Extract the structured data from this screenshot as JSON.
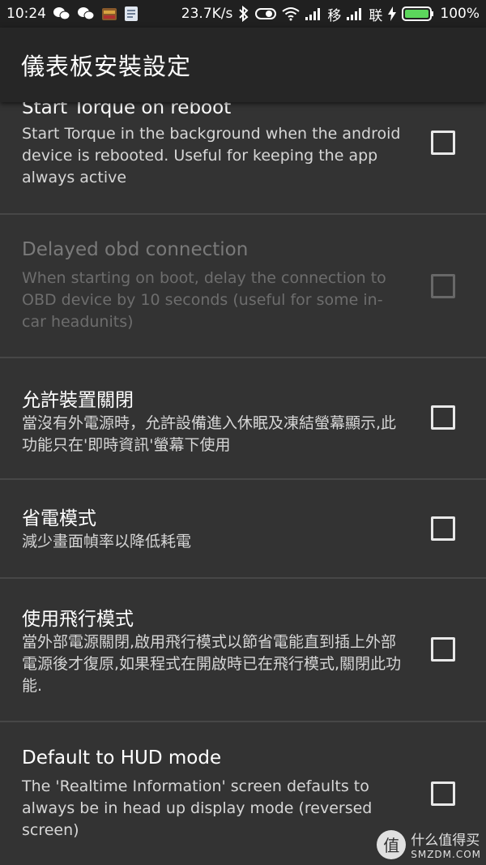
{
  "status_bar": {
    "time": "10:24",
    "net_speed": "23.7K/s",
    "carrier1": "移",
    "carrier2": "联",
    "battery": "100%",
    "icons": [
      "wechat-icon",
      "wechat-icon",
      "app-icon",
      "doc-icon",
      "bluetooth-icon",
      "toggle-icon",
      "wifi-icon",
      "signal-icon",
      "signal-icon",
      "charging-icon",
      "battery-icon"
    ],
    "battery_color": "#5cd65c"
  },
  "toolbar": {
    "title": "儀表板安裝設定"
  },
  "prefs": [
    {
      "title": "Start Torque on reboot",
      "summary": "Start Torque in the background when the android device is rebooted. Useful for keeping the app always active",
      "checked": false,
      "enabled": true
    },
    {
      "title": "Delayed obd connection",
      "summary": "When starting on boot, delay the connection to OBD device  by 10 seconds (useful for some in-car headunits)",
      "checked": false,
      "enabled": false
    },
    {
      "title": "允許裝置關閉",
      "summary": "當沒有外電源時，允許設備進入休眠及凍結螢幕顯示,此功能只在'即時資訊'螢幕下使用",
      "checked": false,
      "enabled": true
    },
    {
      "title": "省電模式",
      "summary": "減少畫面幀率以降低耗電",
      "checked": false,
      "enabled": true
    },
    {
      "title": "使用飛行模式",
      "summary": "當外部電源關閉,啟用飛行模式以節省電能直到插上外部電源後才復原,如果程式在開啟時已在飛行模式,關閉此功能.",
      "checked": false,
      "enabled": true
    },
    {
      "title": "Default to HUD mode",
      "summary": "The 'Realtime Information' screen defaults to always be in head up display mode (reversed screen)",
      "checked": false,
      "enabled": true
    }
  ],
  "watermark": {
    "logo": "值",
    "name": "什么值得买",
    "domain": "SMZDM.COM"
  }
}
